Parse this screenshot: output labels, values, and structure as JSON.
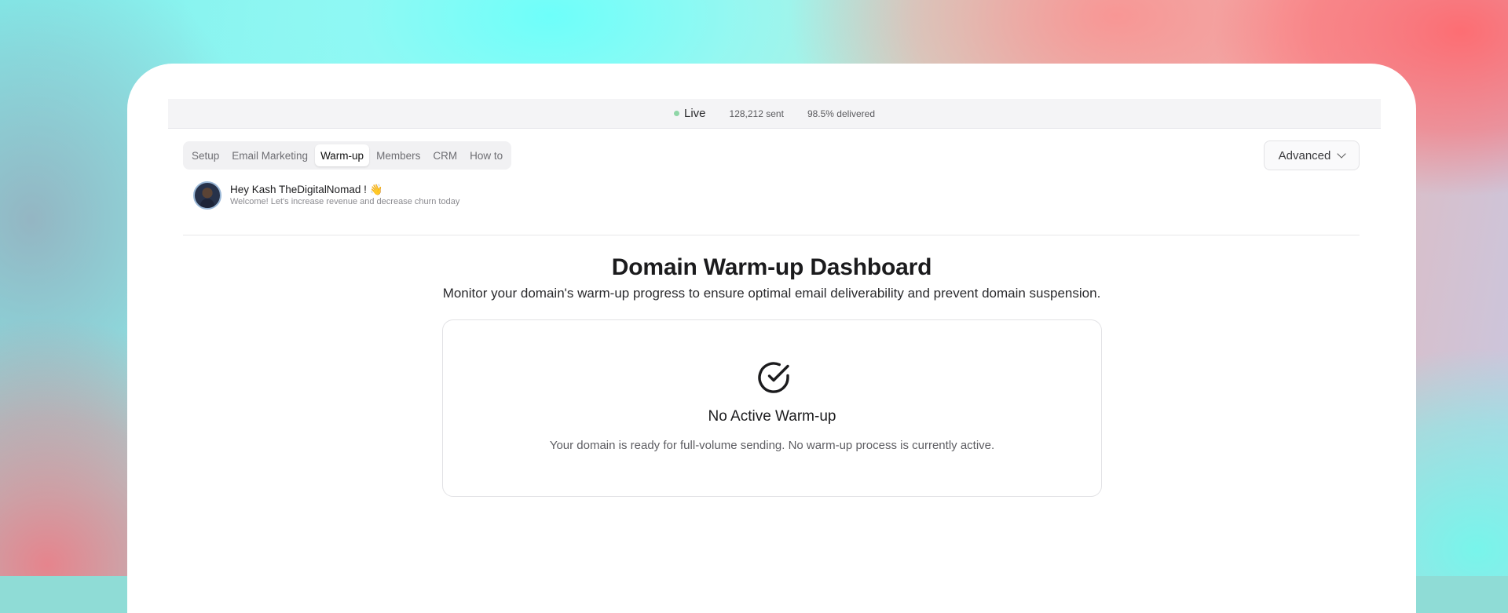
{
  "status": {
    "live_label": "Live",
    "sent": "128,212 sent",
    "delivered": "98.5% delivered",
    "live_color": "#8fd6a7"
  },
  "tabs": [
    {
      "label": "Setup",
      "active": false
    },
    {
      "label": "Email Marketing",
      "active": false
    },
    {
      "label": "Warm-up",
      "active": true
    },
    {
      "label": "Members",
      "active": false
    },
    {
      "label": "CRM",
      "active": false
    },
    {
      "label": "How to",
      "active": false
    }
  ],
  "advanced": {
    "label": "Advanced",
    "icon": "chevron-down-icon"
  },
  "greeting": {
    "title": "Hey Kash TheDigitalNomad ! 👋",
    "subtitle": "Welcome! Let's increase revenue and decrease churn today"
  },
  "page": {
    "title": "Domain Warm-up Dashboard",
    "subtitle": "Monitor your domain's warm-up progress to ensure optimal email deliverability and prevent domain suspension."
  },
  "empty_state": {
    "icon": "check-circle-icon",
    "title": "No Active Warm-up",
    "text": "Your domain is ready for full-volume sending. No warm-up process is currently active."
  }
}
